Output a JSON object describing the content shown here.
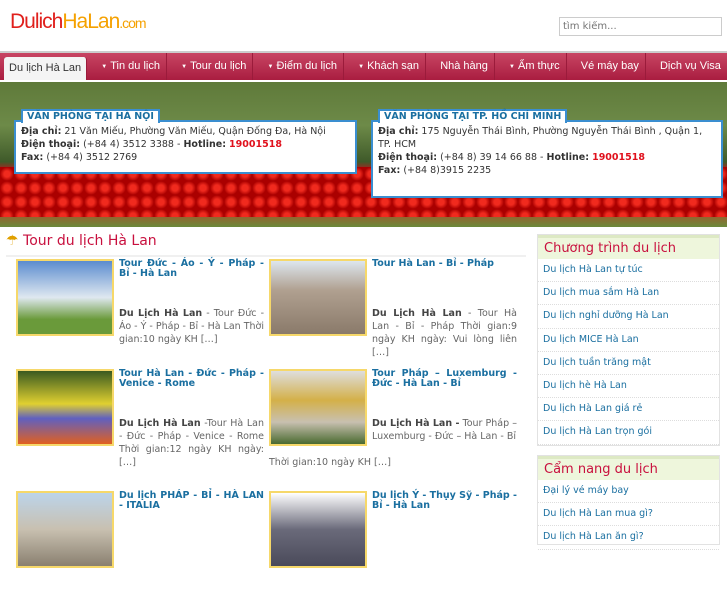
{
  "header": {
    "logo_part1": "Dulich",
    "logo_part2": "HaLan",
    "logo_part3": ".com",
    "search_placeholder": "tìm kiếm..."
  },
  "nav": [
    {
      "label": "Du lịch Hà Lan",
      "active": true
    },
    {
      "label": "Tin du lịch",
      "arrow": true
    },
    {
      "label": "Tour du lịch",
      "arrow": true
    },
    {
      "label": "Điểm du lịch",
      "arrow": true
    },
    {
      "label": "Khách sạn",
      "arrow": true
    },
    {
      "label": "Nhà hàng"
    },
    {
      "label": "Ẩm thực",
      "arrow": true
    },
    {
      "label": "Vé máy bay"
    },
    {
      "label": "Dịch vụ Visa"
    }
  ],
  "offices": [
    {
      "title": "VĂN PHÒNG TẠI HÀ NỘI",
      "addr_label": "Địa chỉ:",
      "addr": "21 Văn Miếu, Phường Văn Miếu, Quận Đống Đa, Hà Nội",
      "phone_label": "Điện thoại:",
      "phone": "(+84 4) 3512 3388 -",
      "hotline_label": "Hotline:",
      "hotline": "19001518",
      "fax_label": "Fax:",
      "fax": "(+84 4) 3512 2769"
    },
    {
      "title": "VĂN PHÒNG TẠI TP. HỒ CHÍ MINH",
      "addr_label": "Địa chỉ:",
      "addr": "175 Nguyễn Thái Bình, Phường Nguyễn Thái Bình , Quận 1, TP. HCM",
      "phone_label": "Điện thoại:",
      "phone": "(+84 8) 39 14 66 88 -",
      "hotline_label": "Hotline:",
      "hotline": "19001518",
      "fax_label": "Fax:",
      "fax": "(+84 8)3915 2235"
    }
  ],
  "section_title": "Tour du lịch Hà Lan",
  "tours": [
    {
      "title": "Tour Đức - Áo - Ý - Pháp - Bỉ - Hà Lan",
      "lead": "Du Lịch Hà Lan",
      "desc": " - Tour Đức - Áo - Ý - Pháp - Bỉ - Hà Lan Thời gian:10 ngày KH […]"
    },
    {
      "title": "Tour Hà Lan - Bỉ - Pháp",
      "lead": "Du Lịch Hà Lan",
      "desc": " - Tour Hà Lan - Bỉ - Pháp Thời gian:9 ngày KH ngày: Vui lòng liên […]"
    },
    {
      "title": "Tour Hà Lan - Đức - Pháp - Venice - Rome",
      "lead": "Du Lịch Hà Lan",
      "desc": " -Tour Hà Lan - Đức - Pháp - Venice - Rome Thời gian:12 ngày KH ngày: […]"
    },
    {
      "title": "Tour Pháp – Luxemburg - Đức - Hà Lan - Bỉ",
      "lead": "Du Lịch Hà Lan -",
      "desc": " Tour Pháp – Luxemburg - Đức – Hà Lan - Bỉ",
      "extra": "Thời gian:10 ngày KH […]"
    },
    {
      "title": "Du lịch PHÁP - BỈ - HÀ LAN - ITALIA"
    },
    {
      "title": "Du lịch Ý - Thụy Sỹ - Pháp - Bỉ - Hà Lan"
    }
  ],
  "sidebar": {
    "programs": {
      "title": "Chương trình du lịch",
      "items": [
        "Du lịch Hà Lan tự túc",
        "Du lịch mua sắm Hà Lan",
        "Du lịch nghỉ dưỡng Hà Lan",
        "Du lịch MICE Hà Lan",
        "Du lịch tuần trăng mật",
        "Du lịch hè Hà Lan",
        "Du lịch Hà Lan giá rẻ",
        "Du lịch Hà Lan trọn gói"
      ]
    },
    "guide": {
      "title": "Cẩm nang du lịch",
      "items": [
        "Đại lý vé máy bay",
        "Du lịch Hà Lan mua gì?",
        "Du lịch Hà Lan ăn gì?"
      ]
    }
  }
}
